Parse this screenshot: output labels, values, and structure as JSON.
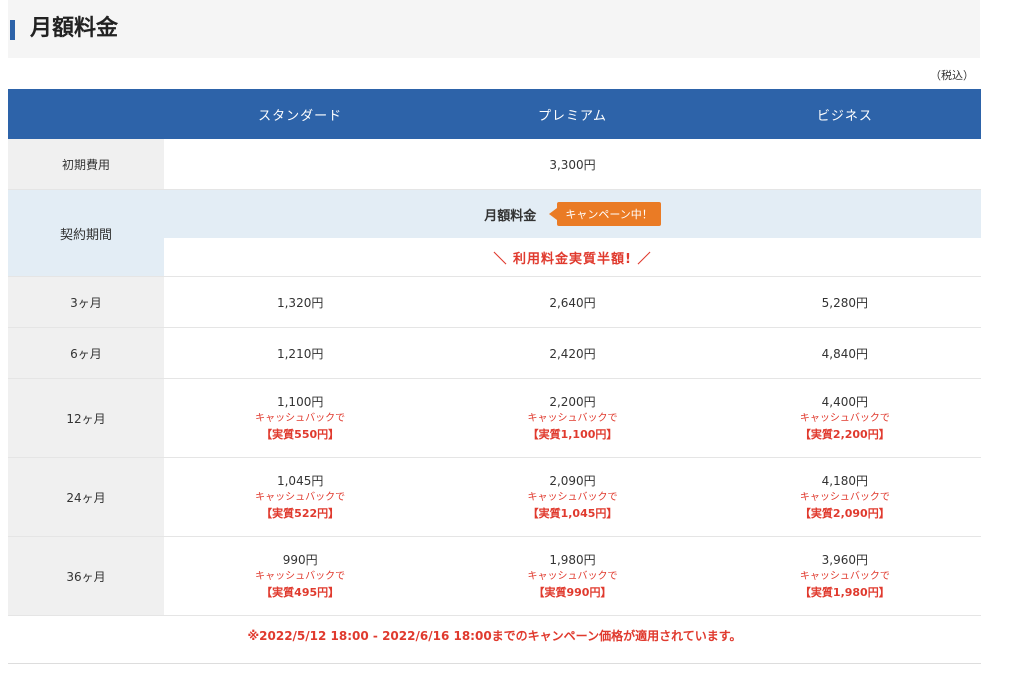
{
  "page": {
    "title": "月額料金",
    "tax_note": "（税込）"
  },
  "table": {
    "headers": [
      "",
      "スタンダード",
      "プレミアム",
      "ビジネス"
    ],
    "initial_fee": {
      "label": "初期費用",
      "value": "3,300円"
    },
    "contract": {
      "label": "契約期間",
      "monthly_label": "月額料金",
      "badge": "キャンペーン中！",
      "half_price": "＼ 利用料金実質半額! ／"
    },
    "rows": [
      {
        "term": "3ヶ月",
        "prices": [
          "1,320円",
          "2,640円",
          "5,280円"
        ]
      },
      {
        "term": "6ヶ月",
        "prices": [
          "1,210円",
          "2,420円",
          "4,840円"
        ]
      },
      {
        "term": "12ヶ月",
        "prices": [
          "1,100円",
          "2,200円",
          "4,400円"
        ],
        "cashback": "キャッシュバックで",
        "effective": [
          "【実質550円】",
          "【実質1,100円】",
          "【実質2,200円】"
        ]
      },
      {
        "term": "24ヶ月",
        "prices": [
          "1,045円",
          "2,090円",
          "4,180円"
        ],
        "cashback": "キャッシュバックで",
        "effective": [
          "【実質522円】",
          "【実質1,045円】",
          "【実質2,090円】"
        ]
      },
      {
        "term": "36ヶ月",
        "prices": [
          "990円",
          "1,980円",
          "3,960円"
        ],
        "cashback": "キャッシュバックで",
        "effective": [
          "【実質495円】",
          "【実質990円】",
          "【実質1,980円】"
        ]
      }
    ]
  },
  "footnote": "※2022/5/12 18:00 - 2022/6/16 18:00までのキャンペーン価格が適用されています。",
  "colors": {
    "header_blue": "#2d63a9",
    "campaign_bg": "#e3edf5",
    "accent_red": "#e03a2e",
    "badge_orange": "#ea7b25"
  }
}
